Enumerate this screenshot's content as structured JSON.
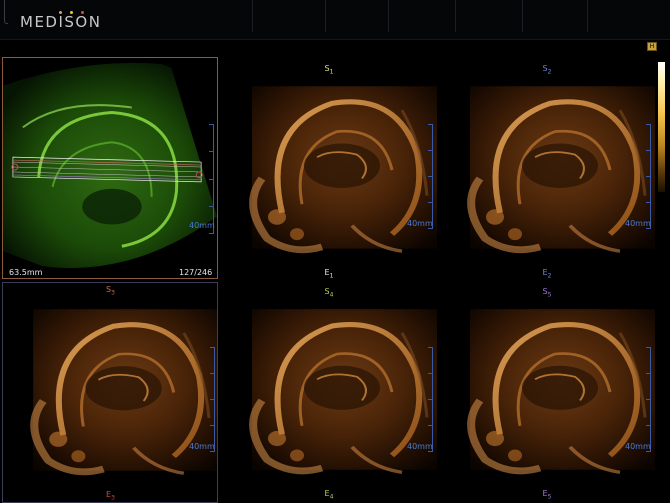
{
  "brand": {
    "name": "MEDISON",
    "dot_colors": [
      "#e8a23a",
      "#f0c040",
      "#e04a3a"
    ]
  },
  "header_badge": "H",
  "mpr": {
    "depth": "40mm",
    "distance": "63.5mm",
    "slice": "127/246"
  },
  "slices": [
    {
      "start": "S",
      "start_num": "1",
      "end": "E",
      "end_num": "1",
      "depth": "40mm",
      "start_color": "#e8e07a",
      "end_color": "#e8e8e8"
    },
    {
      "start": "S",
      "start_num": "2",
      "end": "E",
      "end_num": "2",
      "depth": "40mm",
      "start_color": "#6a8ad6",
      "end_color": "#6a8ad6"
    },
    {
      "start": "S",
      "start_num": "3",
      "end": "E",
      "end_num": "3",
      "depth": "40mm",
      "start_color": "#d06a4a",
      "end_color": "#d04a3a"
    },
    {
      "start": "S",
      "start_num": "4",
      "end": "E",
      "end_num": "4",
      "depth": "40mm",
      "start_color": "#b8d05a",
      "end_color": "#b8d05a"
    },
    {
      "start": "S",
      "start_num": "5",
      "end": "E",
      "end_num": "5",
      "depth": "40mm",
      "start_color": "#9a7ad0",
      "end_color": "#9a7ad0"
    }
  ]
}
